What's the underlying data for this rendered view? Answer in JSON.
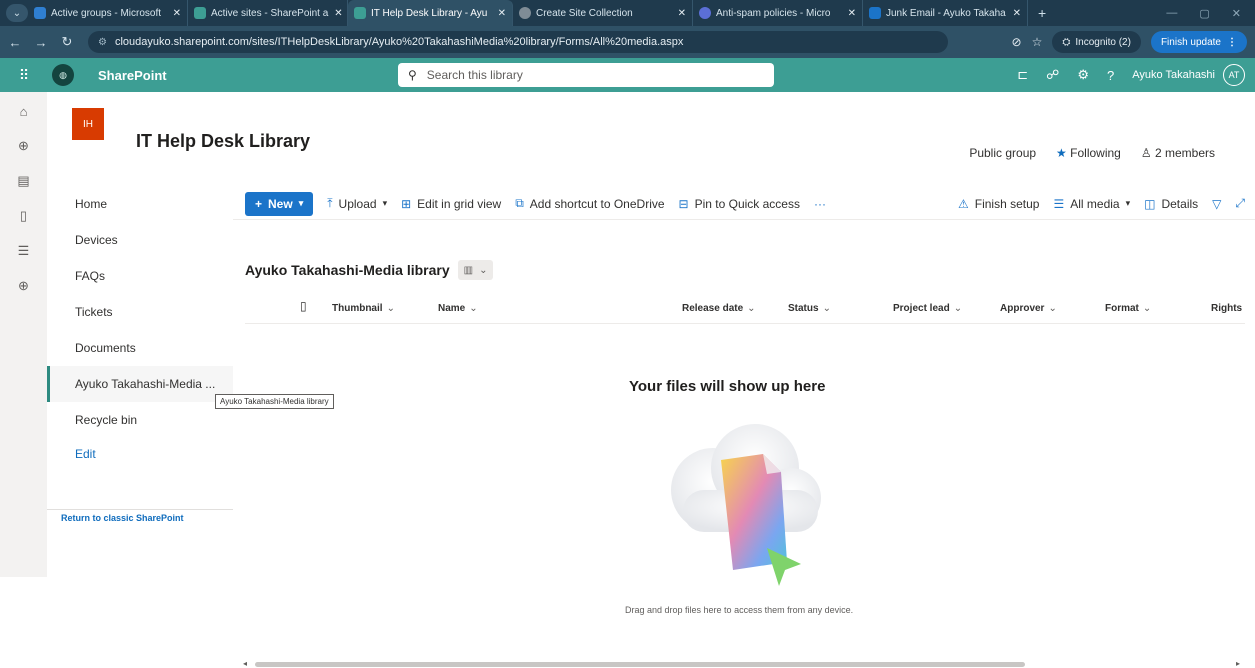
{
  "browser": {
    "tabs": [
      {
        "label": "Active groups - Microsoft",
        "color": "#2f7fd1"
      },
      {
        "label": "Active sites - SharePoint a",
        "color": "#3d9e94"
      },
      {
        "label": "IT Help Desk Library - Ayu",
        "color": "#3d9e94"
      },
      {
        "label": "Create Site Collection",
        "color": "#7f8c96"
      },
      {
        "label": "Anti-spam policies - Micro",
        "color": "#5b6fd6"
      },
      {
        "label": "Junk Email - Ayuko Takaha",
        "color": "#1b74c9"
      }
    ],
    "url": "cloudayuko.sharepoint.com/sites/ITHelpDeskLibrary/Ayuko%20TakahashiMedia%20library/Forms/All%20media.aspx",
    "incognito_label": "Incognito (2)",
    "finish_update_label": "Finish update"
  },
  "suite": {
    "app_name": "SharePoint",
    "search_placeholder": "Search this library",
    "user_name": "Ayuko Takahashi",
    "user_initials": "AT"
  },
  "site": {
    "logo_initials": "IH",
    "title": "IT Help Desk Library",
    "group_type": "Public group",
    "following_label": "Following",
    "members_label": "2 members"
  },
  "nav": {
    "items": [
      "Home",
      "Devices",
      "FAQs",
      "Tickets",
      "Documents",
      "Ayuko Takahashi-Media ...",
      "Recycle bin"
    ],
    "edit_label": "Edit",
    "classic_link": "Return to classic SharePoint",
    "tooltip": "Ayuko Takahashi-Media library"
  },
  "commandbar": {
    "new_label": "New",
    "upload_label": "Upload",
    "grid_label": "Edit in grid view",
    "shortcut_label": "Add shortcut to OneDrive",
    "pin_label": "Pin to Quick access",
    "more_label": "···",
    "finish_setup_label": "Finish setup",
    "view_label": "All media",
    "details_label": "Details"
  },
  "library": {
    "title": "Ayuko Takahashi-Media library",
    "columns": [
      "Thumbnail",
      "Name",
      "Release date",
      "Status",
      "Project lead",
      "Approver",
      "Format",
      "Rights"
    ],
    "empty_title": "Your files will show up here",
    "empty_subtitle": "Drag and drop files here to access them from any device."
  }
}
